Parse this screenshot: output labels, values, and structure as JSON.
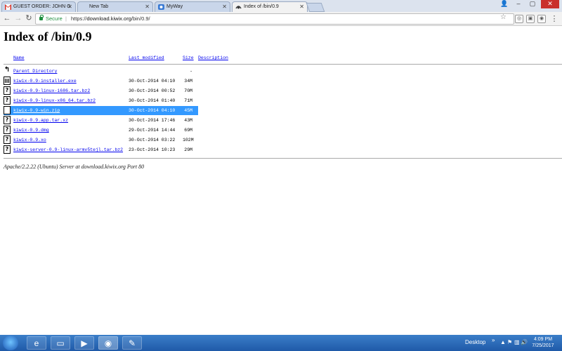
{
  "browser": {
    "tabs": [
      {
        "label": "GUEST ORDER: JOHN G",
        "favicon": "gmail-icon"
      },
      {
        "label": "New Tab",
        "favicon": ""
      },
      {
        "label": "MyWay",
        "favicon": "myway-icon"
      },
      {
        "label": "Index of /bin/0.9",
        "favicon": "page-icon"
      }
    ],
    "secure_label": "Secure",
    "url_prefix": "https://",
    "url_host": "download.kiwix.org",
    "url_path": "/bin/0.9/"
  },
  "page": {
    "title": "Index of /bin/0.9",
    "columns": {
      "name": "Name",
      "modified": "Last modified",
      "size": "Size",
      "description": "Description"
    },
    "parent": {
      "name": "Parent Directory",
      "size": "-"
    },
    "rows": [
      {
        "name": "kiwix-0.9-installer.exe",
        "modified": "30-Oct-2014 04:10",
        "size": "34M",
        "icon": "executable-icon"
      },
      {
        "name": "kiwix-0.9-linux-i686.tar.bz2",
        "modified": "30-Oct-2014 00:52",
        "size": "70M",
        "icon": "unknown-file-icon"
      },
      {
        "name": "kiwix-0.9-linux-x86_64.tar.bz2",
        "modified": "30-Oct-2014 01:40",
        "size": "71M",
        "icon": "unknown-file-icon"
      },
      {
        "name": "kiwix-0.9-win.zip",
        "modified": "30-Oct-2014 04:10",
        "size": "45M",
        "icon": "unknown-file-icon",
        "selected": true
      },
      {
        "name": "kiwix-0.9.app.tar.xz",
        "modified": "30-Oct-2014 17:46",
        "size": "43M",
        "icon": "unknown-file-icon"
      },
      {
        "name": "kiwix-0.9.dmg",
        "modified": "29-Oct-2014 14:44",
        "size": "69M",
        "icon": "unknown-file-icon"
      },
      {
        "name": "kiwix-0.9.xo",
        "modified": "30-Oct-2014 03:22",
        "size": "102M",
        "icon": "unknown-file-icon"
      },
      {
        "name": "kiwix-server-0.9-linux-armv5tejl.tar.bz2",
        "modified": "23-Oct-2014 10:23",
        "size": "29M",
        "icon": "unknown-file-icon"
      }
    ],
    "server_signature": "Apache/2.2.22 (Ubuntu) Server at download.kiwix.org Port 80"
  },
  "taskbar": {
    "desktop_label": "Desktop",
    "time": "4:09 PM",
    "date": "7/25/2017"
  }
}
